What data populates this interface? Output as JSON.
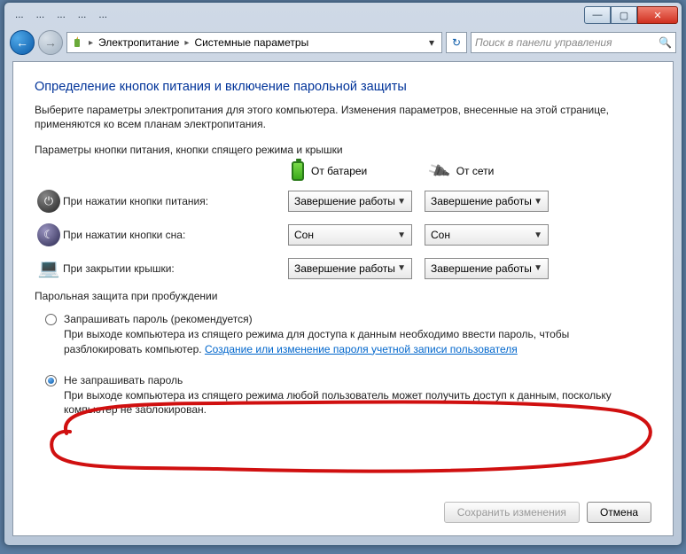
{
  "titlebar": {
    "menu": [
      "...",
      "...",
      "...",
      "...",
      "..."
    ]
  },
  "win": {
    "min": "—",
    "max": "▢",
    "close": "✕"
  },
  "nav": {
    "back": "←",
    "fwd": "→"
  },
  "breadcrumb": {
    "icon": "⚡",
    "seg1": "Электропитание",
    "seg2": "Системные параметры"
  },
  "refresh": "↻",
  "search": {
    "placeholder": "Поиск в панели управления"
  },
  "page": {
    "heading": "Определение кнопок питания и включение парольной защиты",
    "intro": "Выберите параметры электропитания для этого компьютера. Изменения параметров, внесенные на этой странице, применяются ко всем планам электропитания.",
    "section1": "Параметры кнопки питания, кнопки спящего режима и крышки",
    "col_battery": "От батареи",
    "col_ac": "От сети",
    "rows": [
      {
        "label": "При нажатии кнопки питания:",
        "bat": "Завершение работы",
        "ac": "Завершение работы"
      },
      {
        "label": "При нажатии кнопки сна:",
        "bat": "Сон",
        "ac": "Сон"
      },
      {
        "label": "При закрытии крышки:",
        "bat": "Завершение работы",
        "ac": "Завершение работы"
      }
    ],
    "section2": "Парольная защита при пробуждении",
    "opt1": {
      "title": "Запрашивать пароль (рекомендуется)",
      "desc_a": "При выходе компьютера из спящего режима для доступа к данным необходимо ввести пароль, чтобы разблокировать компьютер. ",
      "link": "Создание или изменение пароля учетной записи пользователя"
    },
    "opt2": {
      "title": "Не запрашивать пароль",
      "desc": "При выходе компьютера из спящего режима любой пользователь может получить доступ к данным, поскольку компьютер не заблокирован."
    },
    "save": "Сохранить изменения",
    "cancel": "Отмена"
  }
}
